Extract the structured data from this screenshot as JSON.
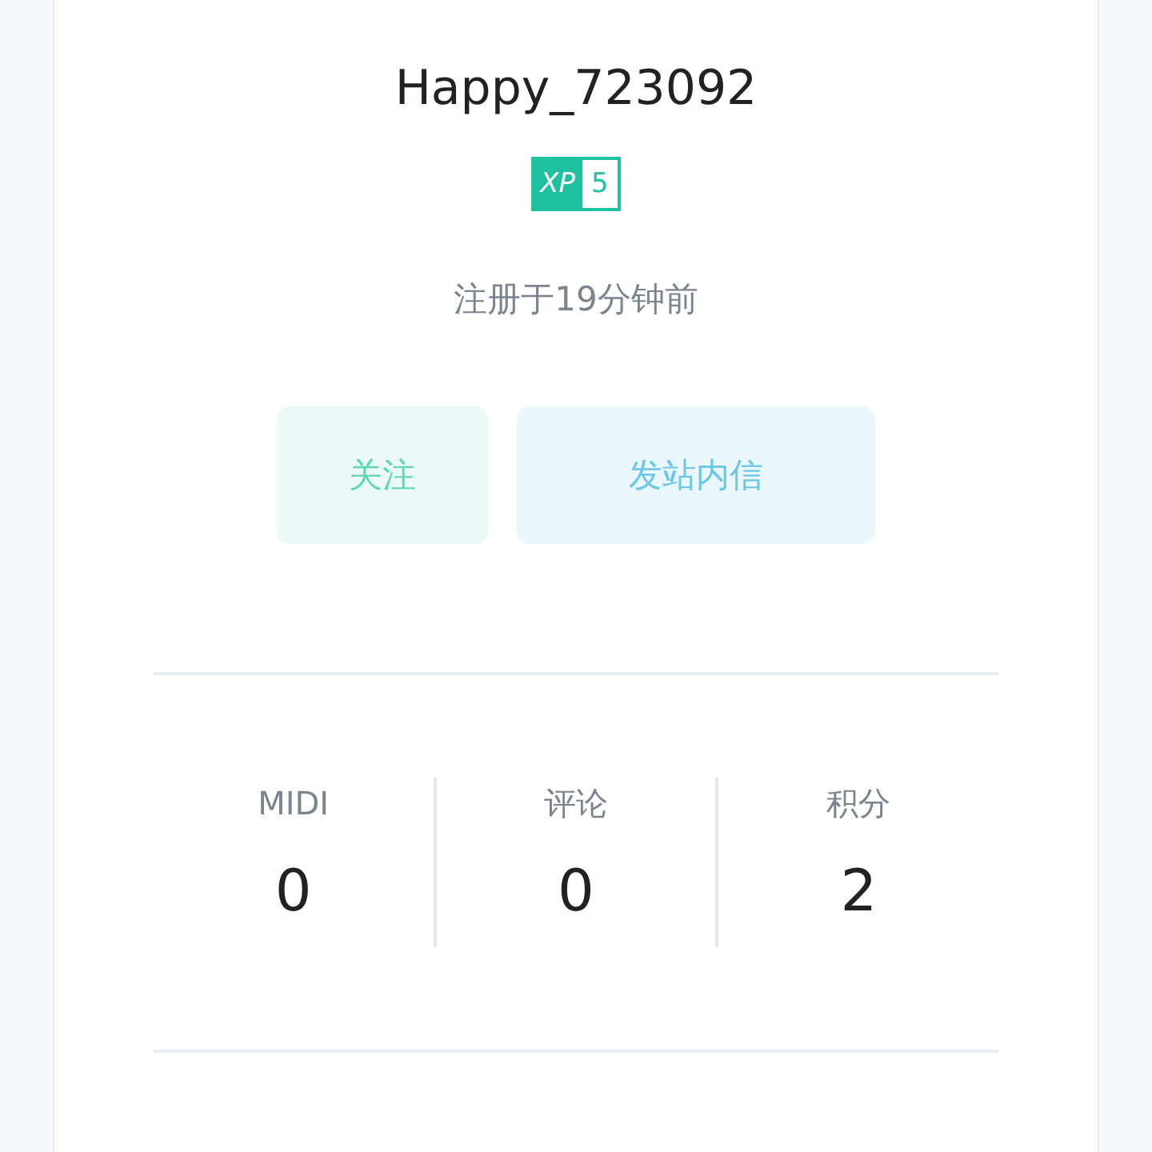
{
  "profile": {
    "username": "Happy_723092",
    "xp_label": "XP",
    "xp_value": "5",
    "registered": "注册于19分钟前"
  },
  "buttons": [
    {
      "kind": "follow",
      "label": "关注"
    },
    {
      "kind": "message",
      "label": "发站内信"
    }
  ],
  "stats": [
    {
      "label": "MIDI",
      "value": "0"
    },
    {
      "label": "评论",
      "value": "0"
    },
    {
      "label": "积分",
      "value": "2"
    }
  ]
}
